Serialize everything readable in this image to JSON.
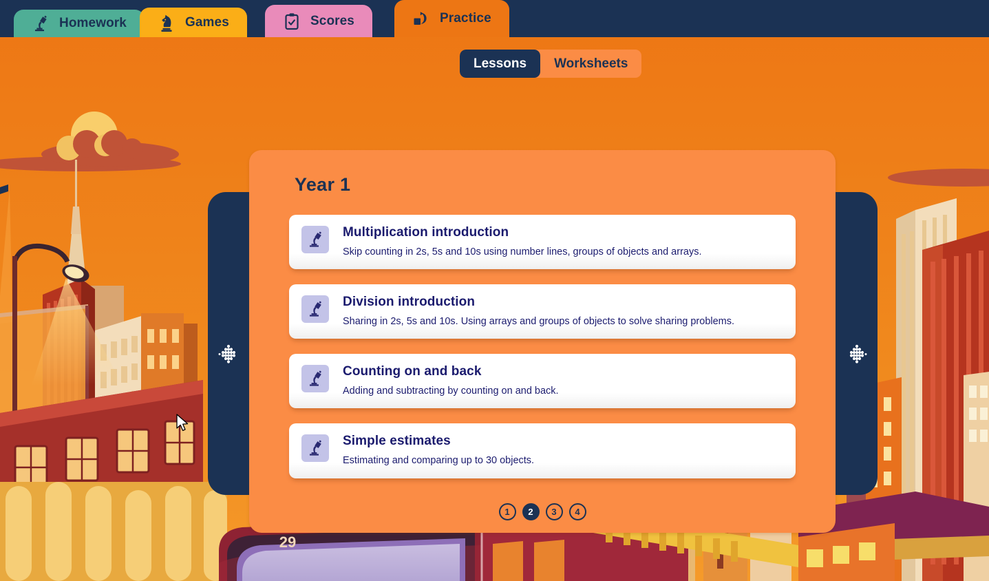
{
  "nav": {
    "tabs": [
      {
        "label": "Homework",
        "icon": "desk-lamp-icon",
        "color": "#4FAE96",
        "active": false
      },
      {
        "label": "Games",
        "icon": "chess-knight-icon",
        "color": "#FBAE17",
        "active": false
      },
      {
        "label": "Scores",
        "icon": "clipboard-check-icon",
        "color": "#E98BBA",
        "active": false
      },
      {
        "label": "Practice",
        "icon": "shapes-icon",
        "color": "#ED7614",
        "active": true
      }
    ]
  },
  "segmented": {
    "options": [
      {
        "label": "Lessons",
        "active": true
      },
      {
        "label": "Worksheets",
        "active": false
      }
    ]
  },
  "carousel": {
    "prev_icon": "dotted-arrow-left-icon",
    "next_icon": "dotted-arrow-right-icon"
  },
  "card": {
    "title": "Year 1",
    "lessons": [
      {
        "icon": "desk-lamp-icon",
        "title": "Multiplication introduction",
        "description": "Skip counting in 2s, 5s and 10s using number lines, groups of objects and arrays."
      },
      {
        "icon": "desk-lamp-icon",
        "title": "Division introduction",
        "description": "Sharing in 2s, 5s and 10s. Using arrays and groups of objects to solve sharing problems."
      },
      {
        "icon": "desk-lamp-icon",
        "title": "Counting on and back",
        "description": "Adding and subtracting by counting on and back."
      },
      {
        "icon": "desk-lamp-icon",
        "title": "Simple estimates",
        "description": "Estimating and comparing up to 30 objects."
      }
    ]
  },
  "pagination": {
    "pages": [
      "1",
      "2",
      "3",
      "4"
    ],
    "active_index": 1
  },
  "background": {
    "scene": "city-skyline-sunset-illustration",
    "tram_route_number": "29"
  },
  "colors": {
    "page_background": "#ED7614",
    "card_background": "#FB8C45",
    "navy": "#1B3254",
    "lesson_title": "#1B1B6E",
    "icon_tile": "#C3C3E8",
    "tab_homework": "#4FAE96",
    "tab_games": "#FBAE17",
    "tab_scores": "#E98BBA",
    "tab_practice": "#ED7614"
  }
}
